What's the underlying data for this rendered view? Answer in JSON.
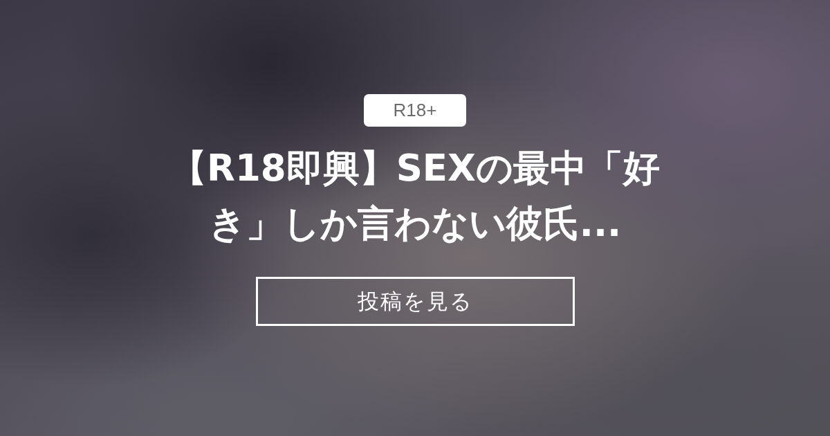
{
  "badge": {
    "label": "R18+"
  },
  "title": "【R18即興】SEXの最中「好き」しか言わない彼氏...",
  "button": {
    "label": "投稿を見る"
  }
}
